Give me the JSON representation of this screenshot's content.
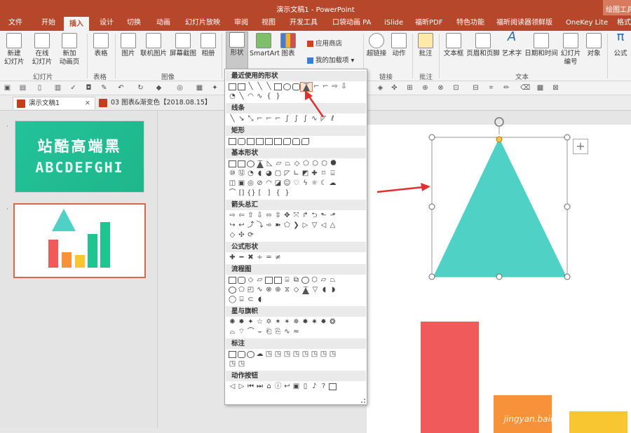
{
  "titlebar": {
    "title": "演示文稿1 - PowerPoint",
    "context_tab": "绘图工具"
  },
  "tabs": [
    "文件",
    "开始",
    "插入",
    "设计",
    "切换",
    "动画",
    "幻灯片放映",
    "审阅",
    "视图",
    "开发工具",
    "口袋动画 PA",
    "iSlide",
    "福昕PDF",
    "特色功能",
    "福昕阅读器领鲜版",
    "OneKey Lite",
    "格式"
  ],
  "active_tab": "插入",
  "ribbon": {
    "new_slide": "新建\n幻灯片",
    "online_slide": "在线\n幻灯片",
    "new_anim_page": "新加\n动画页",
    "table": "表格",
    "picture": "图片",
    "online_picture": "联机图片",
    "screenshot": "屏幕截图",
    "album": "相册",
    "shapes": "形状",
    "smartart": "SmartArt",
    "chart": "图表",
    "app_store": "应用商店",
    "my_addins": "我的加载项",
    "hyperlink": "超链接",
    "action": "动作",
    "comment": "批注",
    "textbox": "文本框",
    "header_footer": "页眉和页脚",
    "wordart": "艺术字",
    "datetime": "日期和时间",
    "slide_number": "幻灯片\n编号",
    "object": "对象",
    "formula": "公式",
    "groups": {
      "slides": "幻灯片",
      "tables": "表格",
      "images": "图像",
      "links": "链接",
      "comments": "批注",
      "text": "文本"
    }
  },
  "doc_tabs": [
    {
      "label": "演示文稿1",
      "close": "✕"
    },
    {
      "label": "03 图表&渐变色【2018.08.15】"
    }
  ],
  "thumbnails": {
    "slide1": {
      "line1": "站酷高端黑",
      "line2": "ABCDEFGHI"
    }
  },
  "shapes_panel": {
    "categories": [
      "最近使用的形状",
      "线条",
      "矩形",
      "基本形状",
      "箭头总汇",
      "公式形状",
      "流程图",
      "星与旗帜",
      "标注",
      "动作按钮"
    ]
  },
  "colors": {
    "accent": "#b7472a",
    "triangle": "#4fd1c5",
    "bar_red": "#f15a5a",
    "bar_orange": "#f7923a",
    "bar_yellow": "#f8c630",
    "bar_green": "#1fc58e"
  },
  "watermark": "jingyan.baidu"
}
